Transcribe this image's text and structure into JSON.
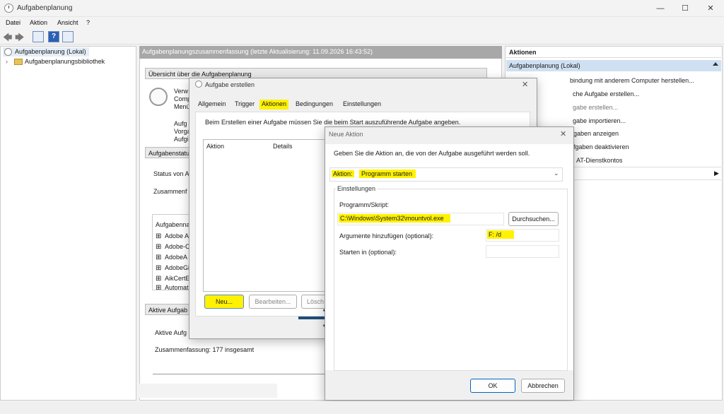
{
  "window": {
    "title": "Aufgabenplanung",
    "minimize": "—",
    "maximize": "☐",
    "close": "✕"
  },
  "menu": [
    "Datei",
    "Aktion",
    "Ansicht",
    "?"
  ],
  "tree": {
    "root": "Aufgabenplanung (Lokal)",
    "library": "Aufgabenplanungsbibliothek"
  },
  "center": {
    "header": "Aufgabenplanungszusammenfassung (letzte Aktualisierung: 11.09.2026 16:43:52)",
    "overview_title": "Übersicht über die Aufgabenplanung",
    "overview_lines": [
      "Verw",
      "Comp",
      "Menü",
      "Aufg",
      "Vorga",
      "Aufgi"
    ],
    "status_title": "Aufgabenstatu",
    "status_von": "Status von A",
    "zusammenf": "Zusammenf",
    "tasks_header": "Aufgabenna",
    "tasks": [
      "Adobe A",
      "Adobe-C",
      "AdobeA",
      "AdobeGi",
      "AikCertE",
      "Automat"
    ],
    "active_title": "Aktive Aufgab",
    "active_label": "Aktive Aufg",
    "summary": "Zusammenfassung: 177 insgesamt"
  },
  "actions": {
    "title": "Aktionen",
    "group": "Aufgabenplanung (Lokal)",
    "items": [
      "bindung mit anderem Computer herstellen...",
      "che Aufgabe erstellen...",
      "gabe erstellen...",
      "gabe importieren...",
      "gaben anzeigen",
      "fgaben deaktivieren",
      "AT-Dienstkontos"
    ]
  },
  "dlg1": {
    "title": "Aufgabe erstellen",
    "tabs": [
      "Allgemein",
      "Trigger",
      "Aktionen",
      "Bedingungen",
      "Einstellungen"
    ],
    "desc": "Beim Erstellen einer Aufgabe müssen Sie die beim Start auszuführende Aufgabe angeben.",
    "col_aktion": "Aktion",
    "col_details": "Details",
    "btn_neu": "Neu...",
    "btn_bearbeiten": "Bearbeiten...",
    "btn_loeschen": "Lösch",
    "close": "✕"
  },
  "dlg2": {
    "title": "Neue Aktion",
    "desc": "Geben Sie die Aktion an, die von der Aufgabe ausgeführt werden soll.",
    "aktion_label": "Aktion:",
    "aktion_value": "Programm starten",
    "settings": "Einstellungen",
    "program_label": "Programm/Skript:",
    "program_value": "C:\\Windows\\System32\\mountvol.exe",
    "browse": "Durchsuchen...",
    "args_label": "Argumente hinzufügen (optional):",
    "args_value": "F: /d",
    "start_label": "Starten in (optional):",
    "ok": "OK",
    "cancel": "Abbrechen",
    "close": "✕"
  },
  "colors": {
    "highlight": "#fff200",
    "arrow": "#1f4e79"
  }
}
